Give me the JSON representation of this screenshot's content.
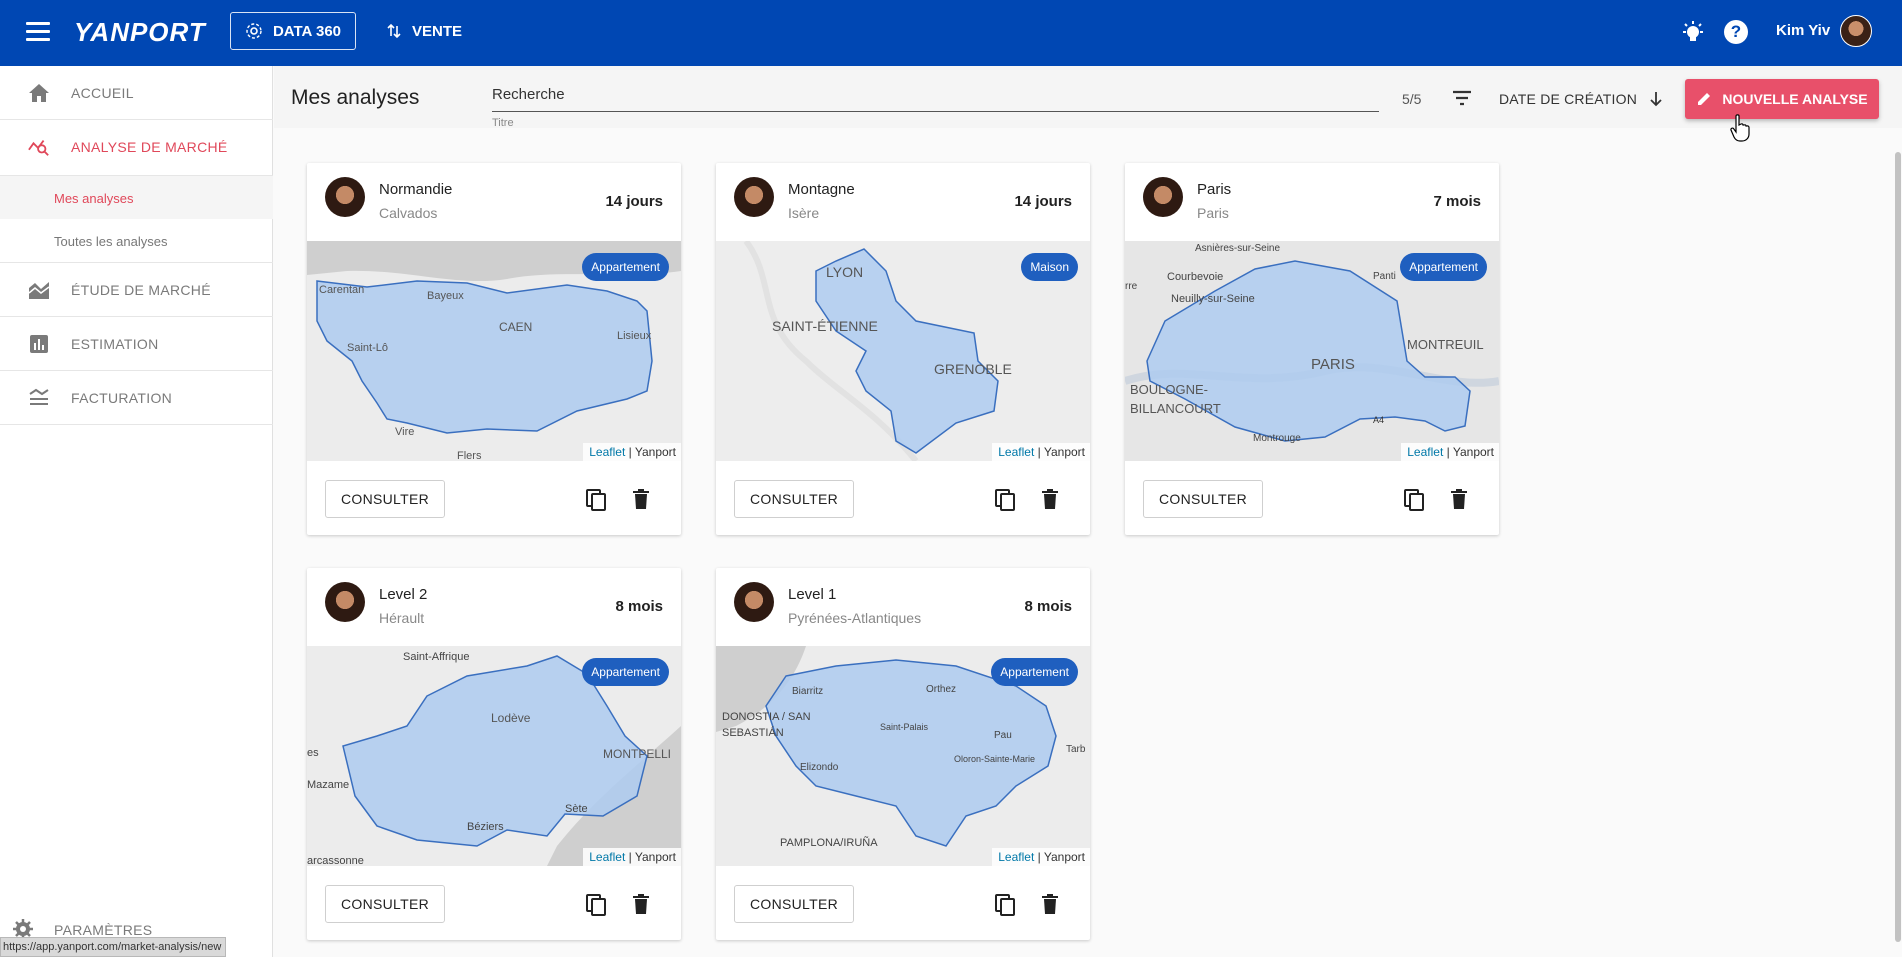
{
  "topbar": {
    "logo": "YANPORT",
    "data360_label": "DATA 360",
    "vente_label": "VENTE",
    "user_name": "Kim Yiv",
    "help_glyph": "?"
  },
  "sidebar": {
    "items": [
      {
        "label": "ACCUEIL",
        "icon": "home-icon"
      },
      {
        "label": "ANALYSE DE MARCHÉ",
        "icon": "market-analysis-icon"
      },
      {
        "label": "ÉTUDE DE MARCHÉ",
        "icon": "market-study-icon"
      },
      {
        "label": "ESTIMATION",
        "icon": "bar-chart-icon"
      },
      {
        "label": "FACTURATION",
        "icon": "billing-icon"
      }
    ],
    "sub_items": [
      "Mes analyses",
      "Toutes les analyses"
    ],
    "settings_label": "PARAMÈTRES",
    "status_url": "https://app.yanport.com/market-analysis/new"
  },
  "header": {
    "title": "Mes analyses",
    "search_value": "Recherche",
    "search_helper": "Titre",
    "count": "5/5",
    "sort_label": "DATE DE CRÉATION",
    "new_button": "NOUVELLE ANALYSE"
  },
  "colors": {
    "topbar": "#0047b3",
    "accent": "#e8506a",
    "badge": "#1f5fbf",
    "polygon": "#aecbf0"
  },
  "cards": [
    {
      "title": "Normandie",
      "subtitle": "Calvados",
      "age": "14 jours",
      "badge": "Appartement",
      "consult": "CONSULTER",
      "leaflet": "Leaflet",
      "yanport": "| Yanport",
      "places": [
        "Bayeux",
        "CAEN",
        "Carentan",
        "Saint-Lô",
        "Lisieux",
        "Vire",
        "Flers"
      ]
    },
    {
      "title": "Montagne",
      "subtitle": "Isère",
      "age": "14 jours",
      "badge": "Maison",
      "consult": "CONSULTER",
      "leaflet": "Leaflet",
      "yanport": "| Yanport",
      "places": [
        "LYON",
        "SAINT-ÉTIENNE",
        "GRENOBLE"
      ]
    },
    {
      "title": "Paris",
      "subtitle": "Paris",
      "age": "7 mois",
      "badge": "Appartement",
      "consult": "CONSULTER",
      "leaflet": "Leaflet",
      "yanport": "| Yanport",
      "places": [
        "Asnières-sur-Seine",
        "Courbevoie",
        "Neuilly-sur-Seine",
        "PARIS",
        "MONTREUIL",
        "BOULOGNE-",
        "BILLANCOURT",
        "Montrouge",
        "A4",
        "Panti",
        "rre"
      ]
    },
    {
      "title": "Level 2",
      "subtitle": "Hérault",
      "age": "8 mois",
      "badge": "Appartement",
      "consult": "CONSULTER",
      "leaflet": "Leaflet",
      "yanport": "| Yanport",
      "places": [
        "Saint-Affrique",
        "Lodève",
        "MONTPELLI",
        "Mazame",
        "Béziers",
        "Sète",
        "arcassonne",
        "es"
      ]
    },
    {
      "title": "Level 1",
      "subtitle": "Pyrénées-Atlantiques",
      "age": "8 mois",
      "badge": "Appartement",
      "consult": "CONSULTER",
      "leaflet": "Leaflet",
      "yanport": "| Yanport",
      "places": [
        "Biarritz",
        "Orthez",
        "DONOSTIA / SAN",
        "SEBASTIÁN",
        "Saint-Palais",
        "Pau",
        "Oloron-Sainte-Marie",
        "Elizondo",
        "PAMPLONA/IRUÑA",
        "Tarb"
      ]
    }
  ]
}
